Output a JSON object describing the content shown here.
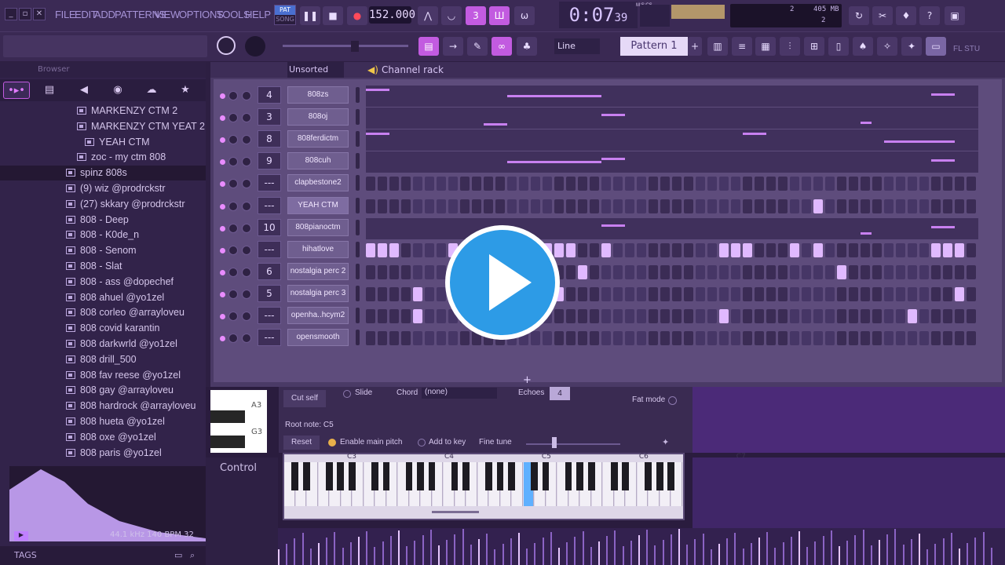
{
  "menu": {
    "items": [
      "FILE",
      "EDIT",
      "ADD",
      "PATTERNS",
      "VIEW",
      "OPTIONS",
      "TOOLS",
      "HELP"
    ]
  },
  "transport": {
    "pat_label": "PAT",
    "song_label": "SONG",
    "tempo": "152.000",
    "time": "0:07",
    "time_fraction": "39",
    "time_unit": "M:S:CS",
    "memory": "405 MB",
    "cpu_value": "2",
    "poly_value": "2"
  },
  "toolbar2": {
    "snap_mode": "Line",
    "pattern_name": "Pattern 1",
    "fl_studio_label": "FL STU"
  },
  "browser": {
    "title": "Browser",
    "sort_label": "Unsorted",
    "items": [
      {
        "label": "MARKENZY CTM 2",
        "indent": 98
      },
      {
        "label": "MARKENZY CTM YEAT 2",
        "indent": 98
      },
      {
        "label": "YEAH CTM",
        "indent": 108
      },
      {
        "label": "zoc - my ctm 808",
        "indent": 98
      },
      {
        "label": "spinz 808s",
        "indent": 84
      },
      {
        "label": "(9) wiz @prodrckstr",
        "indent": 84
      },
      {
        "label": "(27) skkary @prodrckstr",
        "indent": 84
      },
      {
        "label": "808 - Deep",
        "indent": 84
      },
      {
        "label": "808 - K0de_n",
        "indent": 84
      },
      {
        "label": "808 - Senom",
        "indent": 84
      },
      {
        "label": "808 - Slat",
        "indent": 84
      },
      {
        "label": "808 - ass @dopechef",
        "indent": 84
      },
      {
        "label": "808 ahuel @yo1zel",
        "indent": 84
      },
      {
        "label": "808 corleo @arrayloveu",
        "indent": 84
      },
      {
        "label": "808 covid karantin",
        "indent": 84
      },
      {
        "label": "808 darkwrld @yo1zel",
        "indent": 84
      },
      {
        "label": "808 drill_500",
        "indent": 84
      },
      {
        "label": "808 fav reese @yo1zel",
        "indent": 84
      },
      {
        "label": "808 gay @arrayloveu",
        "indent": 84
      },
      {
        "label": "808 hardrock @arrayloveu",
        "indent": 84
      },
      {
        "label": "808 hueta @yo1zel",
        "indent": 84
      },
      {
        "label": "808 oxe @yo1zel",
        "indent": 84
      },
      {
        "label": "808 paris @yo1zel",
        "indent": 84
      }
    ],
    "sample_info": "44.1 kHz 140 BPM 32",
    "tags_label": "TAGS"
  },
  "channel_rack": {
    "title": "Channel rack",
    "channels": [
      {
        "num": "4",
        "name": "808zs",
        "type": "roll"
      },
      {
        "num": "3",
        "name": "808oj",
        "type": "roll"
      },
      {
        "num": "8",
        "name": "808ferdictm",
        "type": "roll"
      },
      {
        "num": "9",
        "name": "808cuh",
        "type": "roll"
      },
      {
        "num": "---",
        "name": "clapbestone2",
        "type": "steps"
      },
      {
        "num": "---",
        "name": "YEAH CTM",
        "type": "steps"
      },
      {
        "num": "10",
        "name": "808pianoctm",
        "type": "roll"
      },
      {
        "num": "---",
        "name": "hihatlove",
        "type": "steps"
      },
      {
        "num": "6",
        "name": "nostalgia perc 2",
        "type": "steps"
      },
      {
        "num": "5",
        "name": "nostalgia perc 3",
        "type": "steps"
      },
      {
        "num": "---",
        "name": "openha..hcym2",
        "type": "steps"
      },
      {
        "num": "---",
        "name": "opensmooth",
        "type": "steps"
      }
    ],
    "add_label": "+"
  },
  "sampler": {
    "cut_self": "Cut self",
    "slide": "Slide",
    "chord_label": "Chord",
    "chord_value": "(none)",
    "echoes_label": "Echoes",
    "echoes_value": "4",
    "fat_mode": "Fat mode",
    "root_note": "Root note: C5",
    "reset": "Reset",
    "enable_main_pitch": "Enable main pitch",
    "add_to_key": "Add to key",
    "fine_tune": "Fine tune",
    "octaves": [
      "C3",
      "C4",
      "C5",
      "C6",
      "C7"
    ],
    "left_keys": [
      "A3",
      "G3"
    ]
  },
  "control": {
    "label": "Control"
  },
  "colors": {
    "accent": "#c25be0",
    "play": "#2d9be6"
  }
}
